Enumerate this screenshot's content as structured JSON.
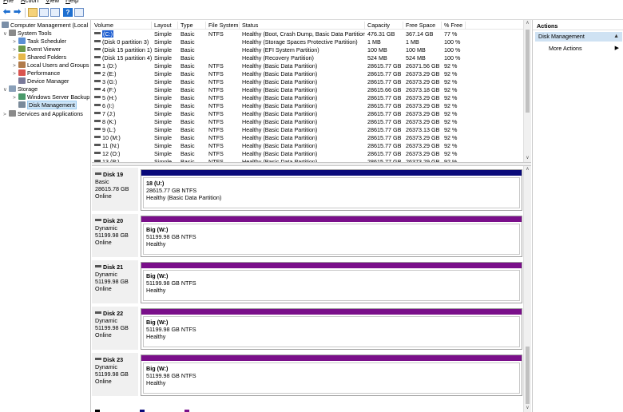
{
  "menu": [
    {
      "label": "File",
      "key": "F",
      "rest": "ile"
    },
    {
      "label": "Action",
      "key": "A",
      "rest": "ction"
    },
    {
      "label": "View",
      "key": "V",
      "rest": "iew"
    },
    {
      "label": "Help",
      "key": "H",
      "rest": "elp"
    }
  ],
  "toolbar": {
    "help_glyph": "?"
  },
  "tree": {
    "root": "Computer Management (Local",
    "system_tools": "System Tools",
    "task_scheduler": "Task Scheduler",
    "event_viewer": "Event Viewer",
    "shared_folders": "Shared Folders",
    "local_users": "Local Users and Groups",
    "performance": "Performance",
    "device_manager": "Device Manager",
    "storage": "Storage",
    "windows_backup": "Windows Server Backup",
    "disk_management": "Disk Management",
    "services": "Services and Applications"
  },
  "volumes": {
    "headers": [
      "Volume",
      "Layout",
      "Type",
      "File System",
      "Status",
      "Capacity",
      "Free Space",
      "% Free"
    ],
    "rows": [
      [
        "(C:)",
        "Simple",
        "Basic",
        "NTFS",
        "Healthy (Boot, Crash Dump, Basic Data Partition)",
        "476.31 GB",
        "367.14 GB",
        "77 %"
      ],
      [
        "(Disk 0 partition 3)",
        "Simple",
        "Basic",
        "",
        "Healthy (Storage Spaces Protective Partition)",
        "1 MB",
        "1 MB",
        "100 %"
      ],
      [
        "(Disk 15 partition 1)",
        "Simple",
        "Basic",
        "",
        "Healthy (EFI System Partition)",
        "100 MB",
        "100 MB",
        "100 %"
      ],
      [
        "(Disk 15 partition 4)",
        "Simple",
        "Basic",
        "",
        "Healthy (Recovery Partition)",
        "524 MB",
        "524 MB",
        "100 %"
      ],
      [
        "1 (D:)",
        "Simple",
        "Basic",
        "NTFS",
        "Healthy (Basic Data Partition)",
        "28615.77 GB",
        "26371.56 GB",
        "92 %"
      ],
      [
        "2 (E:)",
        "Simple",
        "Basic",
        "NTFS",
        "Healthy (Basic Data Partition)",
        "28615.77 GB",
        "26373.29 GB",
        "92 %"
      ],
      [
        "3 (G:)",
        "Simple",
        "Basic",
        "NTFS",
        "Healthy (Basic Data Partition)",
        "28615.77 GB",
        "26373.29 GB",
        "92 %"
      ],
      [
        "4 (F:)",
        "Simple",
        "Basic",
        "NTFS",
        "Healthy (Basic Data Partition)",
        "28615.66 GB",
        "26373.18 GB",
        "92 %"
      ],
      [
        "5 (H:)",
        "Simple",
        "Basic",
        "NTFS",
        "Healthy (Basic Data Partition)",
        "28615.77 GB",
        "26373.29 GB",
        "92 %"
      ],
      [
        "6 (I:)",
        "Simple",
        "Basic",
        "NTFS",
        "Healthy (Basic Data Partition)",
        "28615.77 GB",
        "26373.29 GB",
        "92 %"
      ],
      [
        "7 (J:)",
        "Simple",
        "Basic",
        "NTFS",
        "Healthy (Basic Data Partition)",
        "28615.77 GB",
        "26373.29 GB",
        "92 %"
      ],
      [
        "8 (K:)",
        "Simple",
        "Basic",
        "NTFS",
        "Healthy (Basic Data Partition)",
        "28615.77 GB",
        "26373.29 GB",
        "92 %"
      ],
      [
        "9 (L:)",
        "Simple",
        "Basic",
        "NTFS",
        "Healthy (Basic Data Partition)",
        "28615.77 GB",
        "26373.13 GB",
        "92 %"
      ],
      [
        "10 (M:)",
        "Simple",
        "Basic",
        "NTFS",
        "Healthy (Basic Data Partition)",
        "28615.77 GB",
        "26373.29 GB",
        "92 %"
      ],
      [
        "11 (N:)",
        "Simple",
        "Basic",
        "NTFS",
        "Healthy (Basic Data Partition)",
        "28615.77 GB",
        "26373.29 GB",
        "92 %"
      ],
      [
        "12 (O:)",
        "Simple",
        "Basic",
        "NTFS",
        "Healthy (Basic Data Partition)",
        "28615.77 GB",
        "26373.29 GB",
        "92 %"
      ],
      [
        "13 (P:)",
        "Simple",
        "Basic",
        "NTFS",
        "Healthy (Basic Data Partition)",
        "28615.77 GB",
        "26373.29 GB",
        "92 %"
      ]
    ]
  },
  "disks": [
    {
      "name": "Disk 19",
      "type": "Basic",
      "size": "28615.78 GB",
      "state": "Online",
      "part_name": "18  (U:)",
      "part_size": "28615.77 GB NTFS",
      "part_status": "Healthy (Basic Data Partition)",
      "color": "#0a0a7a"
    },
    {
      "name": "Disk 20",
      "type": "Dynamic",
      "size": "51199.98 GB",
      "state": "Online",
      "part_name": "Big  (W:)",
      "part_size": "51199.98 GB NTFS",
      "part_status": "Healthy",
      "color": "#7a0f8a"
    },
    {
      "name": "Disk 21",
      "type": "Dynamic",
      "size": "51199.98 GB",
      "state": "Online",
      "part_name": "Big  (W:)",
      "part_size": "51199.98 GB NTFS",
      "part_status": "Healthy",
      "color": "#7a0f8a"
    },
    {
      "name": "Disk 22",
      "type": "Dynamic",
      "size": "51199.98 GB",
      "state": "Online",
      "part_name": "Big  (W:)",
      "part_size": "51199.98 GB NTFS",
      "part_status": "Healthy",
      "color": "#7a0f8a"
    },
    {
      "name": "Disk 23",
      "type": "Dynamic",
      "size": "51199.98 GB",
      "state": "Online",
      "part_name": "Big  (W:)",
      "part_size": "51199.98 GB NTFS",
      "part_status": "Healthy",
      "color": "#7a0f8a"
    }
  ],
  "actions": {
    "title": "Actions",
    "section": "Disk Management",
    "more": "More Actions"
  },
  "colors": {
    "basic_partition": "#0a0a7a",
    "dynamic_volume": "#7a0f8a",
    "selection": "#1f5fd1"
  }
}
